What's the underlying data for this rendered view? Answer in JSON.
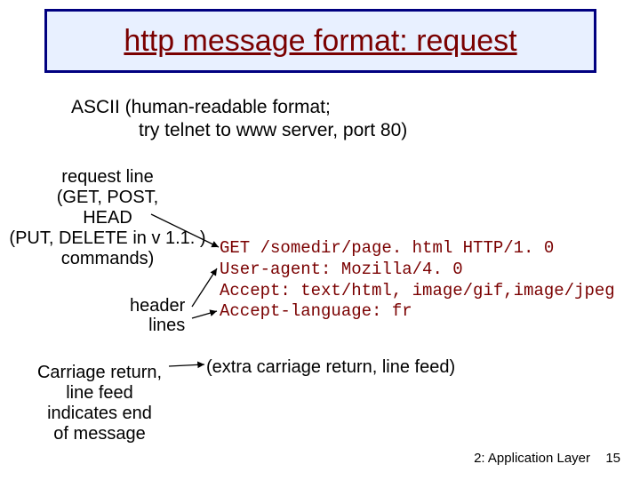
{
  "title": "http message format: request",
  "subtitle_line1": "ASCII (human-readable format;",
  "subtitle_line2": "try telnet to www server, port 80)",
  "labels": {
    "request_line_1": "request line",
    "request_line_2": "(GET, POST,",
    "request_line_3": "HEAD",
    "request_line_4": "(PUT, DELETE in v 1.1. )",
    "request_line_5": "commands)",
    "header": "header",
    "lines": "lines",
    "carriage_1": "Carriage return,",
    "carriage_2": "line feed",
    "carriage_3": "indicates end",
    "carriage_4": "of message"
  },
  "code": {
    "l1": "GET /somedir/page. html HTTP/1. 0",
    "l2": "User-agent: Mozilla/4. 0",
    "l3": "Accept: text/html, image/gif,image/jpeg",
    "l4": "Accept-language: fr"
  },
  "extra": "(extra carriage return, line feed)",
  "footer": {
    "chapter": "2: Application Layer",
    "page": "15"
  }
}
